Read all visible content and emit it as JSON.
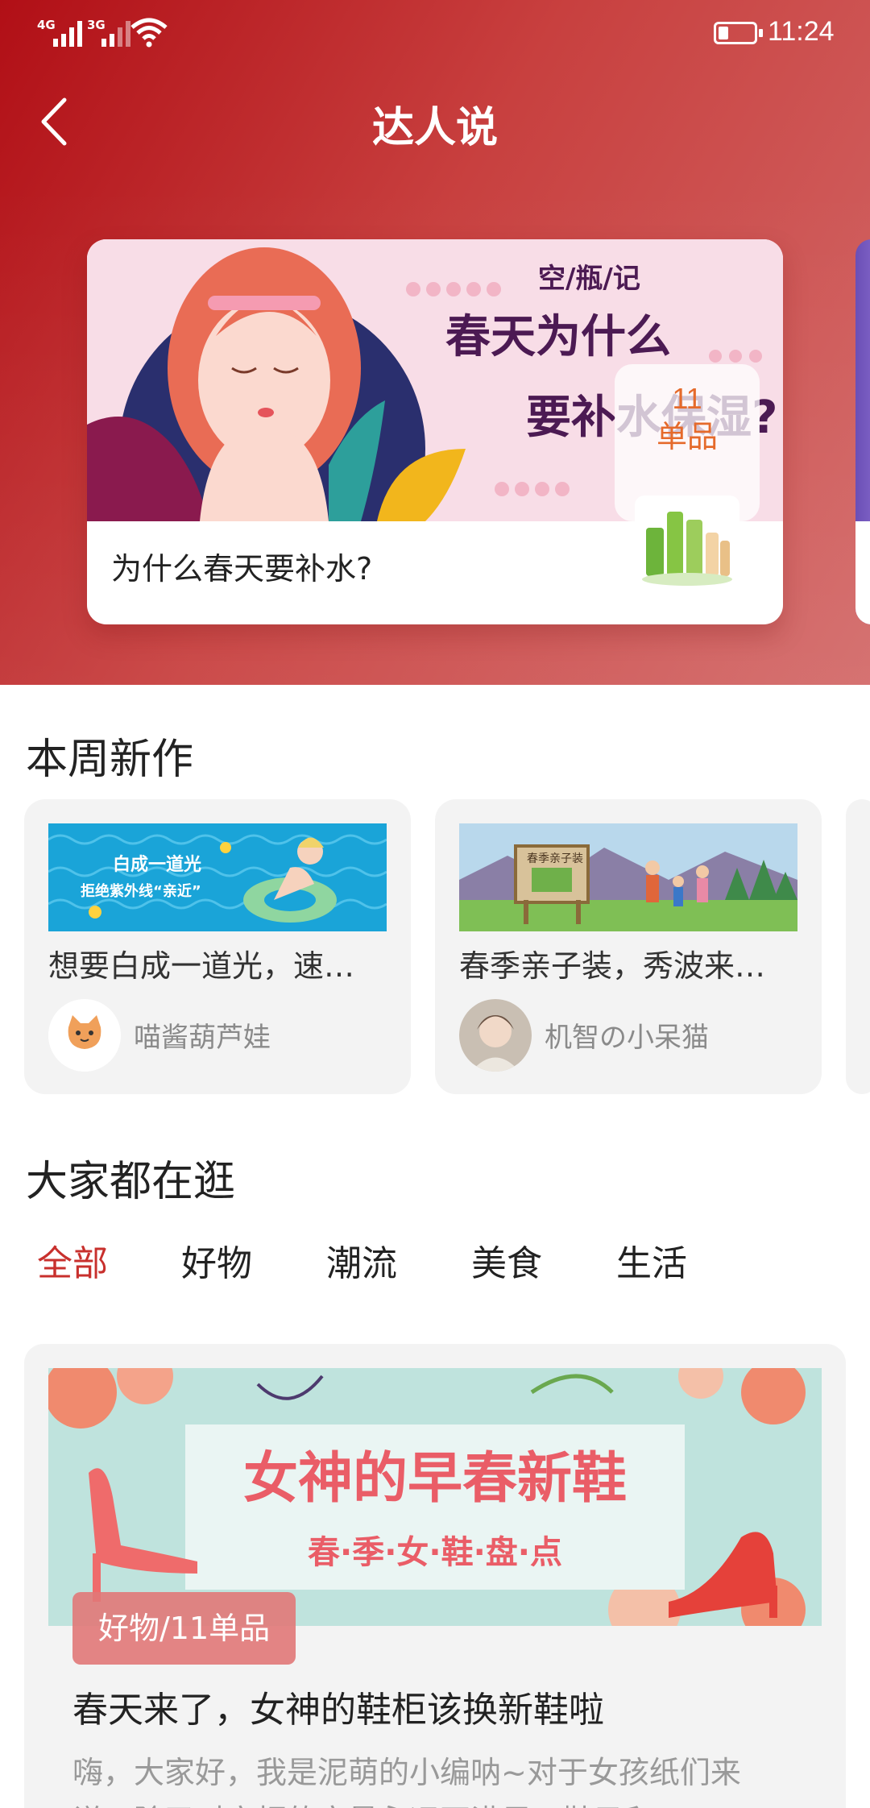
{
  "status": {
    "signal1": "4G",
    "signal2": "3G",
    "time": "11:24"
  },
  "header": {
    "title": "达人说"
  },
  "featured": {
    "caption": "为什么春天要补水?",
    "banner_tag": "空/瓶/记",
    "banner_line1": "春天为什么",
    "banner_line2": "要补水保湿?",
    "count": "11",
    "count_unit": "单品"
  },
  "weekly": {
    "title": "本周新作",
    "items": [
      {
        "banner_line1": "白成一道光",
        "banner_line2": "拒绝紫外线“亲近”",
        "text": "想要白成一道光，速…",
        "author": "喵酱葫芦娃"
      },
      {
        "banner_sign": "春季亲子装",
        "text": "春季亲子装，秀波来…",
        "author": "机智の小呆猫"
      }
    ]
  },
  "browse": {
    "title": "大家都在逛",
    "tabs": [
      "全部",
      "好物",
      "潮流",
      "美食",
      "生活"
    ],
    "active_tab": 0
  },
  "feed": {
    "banner_title": "女神的早春新鞋",
    "banner_sub": "春·季·女·鞋·盘·点",
    "badge": "好物/11单品",
    "title": "春天来了，女神的鞋柜该换新鞋啦",
    "desc": "嗨，大家好，我是泥萌的小编呐~对于女孩纸们来说，除了对衣柜的容量永远不满足，鞋子和…"
  },
  "colors": {
    "accent": "#c8302d",
    "header_start": "#b10f16",
    "header_end": "#d36a69"
  }
}
